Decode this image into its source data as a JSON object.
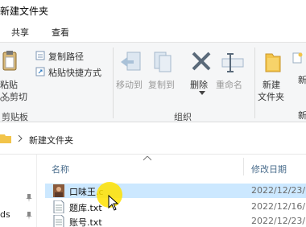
{
  "window": {
    "title": "新建文件夹"
  },
  "tabs": [
    {
      "label": "共享"
    },
    {
      "label": "查看"
    }
  ],
  "ribbon": {
    "clipboard": {
      "paste_label": "粘贴",
      "cut_label": "剪切",
      "copy_path_label": "复制路径",
      "paste_shortcut_label": "粘贴快捷方式",
      "group_label": "剪贴板"
    },
    "organize": {
      "move_to_label": "移动到",
      "copy_to_label": "复制到",
      "delete_label": "删除",
      "rename_label": "重命名",
      "group_label": "组织"
    },
    "new": {
      "new_folder_label_line1": "新建",
      "new_folder_label_line2": "文件夹"
    },
    "side_letter_1": "新",
    "side_letter_2": "新"
  },
  "address": {
    "current_folder": "新建文件夹"
  },
  "nav": {
    "item_fragment": "ds"
  },
  "file_list": {
    "columns": {
      "name": "名称",
      "modified": "修改日期"
    },
    "rows": [
      {
        "name": "口味王.c",
        "modified": "2022/12/23/",
        "selected": true,
        "icon": "image-file-icon"
      },
      {
        "name": "题库.txt",
        "modified": "2022/12/16/",
        "selected": false,
        "icon": "text-file-icon"
      },
      {
        "name": "账号.txt",
        "modified": "2022/12/23/",
        "selected": false,
        "icon": "text-file-icon"
      }
    ]
  },
  "colors": {
    "accent_blue": "#2b79c2",
    "selection": "#cce8ff",
    "cursor_highlight": "#ffe200"
  }
}
